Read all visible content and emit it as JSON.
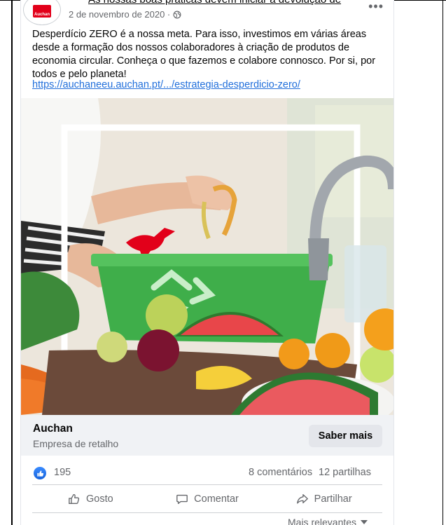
{
  "header": {
    "cut_text": "As nossas boas práticas devem iniciar a devolução de",
    "page_name": "Auchan",
    "date": "2 de novembro de 2020 ·",
    "logo_text": "Auchan",
    "more_glyph": "•••"
  },
  "post": {
    "text": "Desperdício ZERO é a nossa meta. Para isso, investimos em várias áreas desde a formação dos nossos colaboradores à criação de produtos de economia circular. Conheça o que fazemos e colabore connosco. Por si, por todos e pelo planeta!",
    "link": "https://auchaneeu.auchan.pt/.../estrategia-desperdicio-zero/"
  },
  "cta": {
    "title": "Auchan",
    "subtitle": "Empresa de retalho",
    "button": "Saber mais"
  },
  "stats": {
    "likes": "195",
    "comments": "8 comentários",
    "shares": "12 partilhas"
  },
  "actions": {
    "like": "Gosto",
    "comment": "Comentar",
    "share": "Partilhar"
  },
  "sort": {
    "label": "Mais relevantes"
  },
  "colors": {
    "link": "#216fdb",
    "brand_red": "#e2001a",
    "cta_bg": "#f0f2f5",
    "like_blue": "#1877f2"
  },
  "icons": [
    "globe-icon",
    "like-badge-icon",
    "thumbs-up-icon",
    "comment-icon",
    "share-icon",
    "chevron-down-icon"
  ]
}
